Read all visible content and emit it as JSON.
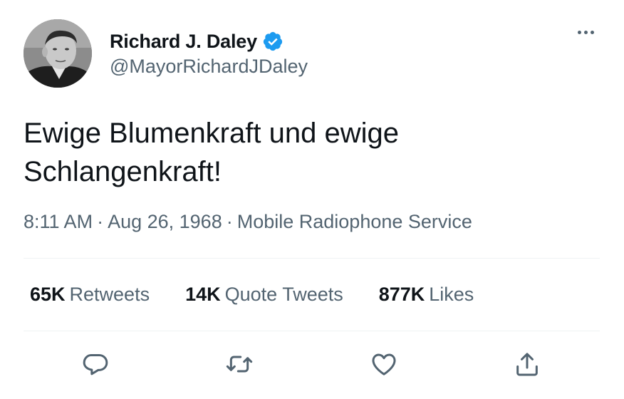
{
  "author": {
    "name": "Richard J. Daley",
    "handle": "@MayorRichardJDaley",
    "verified": true,
    "verified_color": "#1d9bf0"
  },
  "tweet": {
    "text": "Ewige Blumenkraft und ewige Schlangenkraft!"
  },
  "meta": {
    "time": "8:11 AM",
    "separator": "·",
    "date": "Aug 26, 1968",
    "source": "Mobile Radiophone Service"
  },
  "stats": [
    {
      "count": "65K",
      "label": "Retweets"
    },
    {
      "count": "14K",
      "label": "Quote Tweets"
    },
    {
      "count": "877K",
      "label": "Likes"
    }
  ],
  "actions": [
    "reply-icon",
    "retweet-icon",
    "like-icon",
    "share-icon"
  ],
  "colors": {
    "text_primary": "#0f1419",
    "text_secondary": "#536471",
    "divider": "#eff3f4"
  }
}
